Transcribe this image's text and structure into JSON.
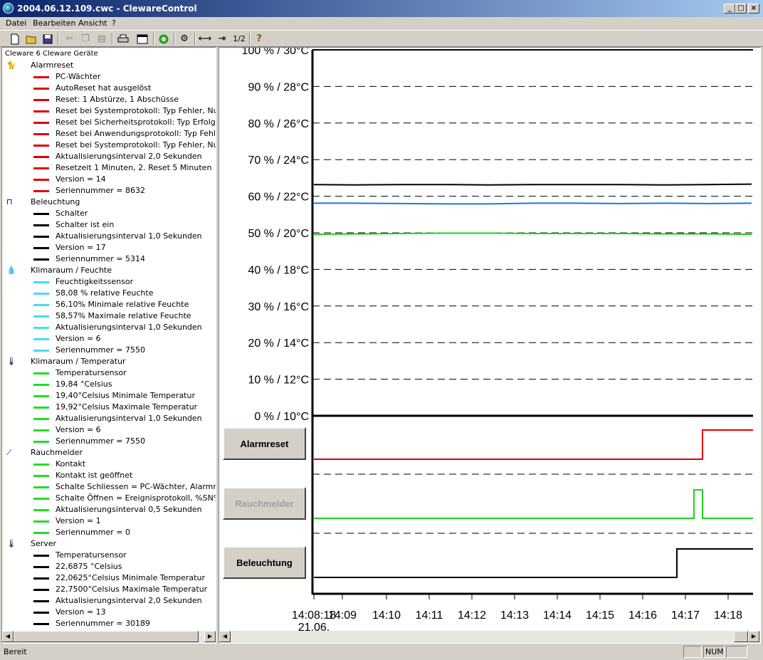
{
  "window": {
    "title": "2004.06.12.109.cwc - ClewareControl",
    "min": "_",
    "max": "□",
    "close": "×"
  },
  "menu": [
    "Datei",
    "Bearbeiten",
    "Ansicht",
    "?"
  ],
  "toolbar": {
    "zoom_label": "1/2"
  },
  "tree": {
    "root": "Cleware 6 Cleware Geräte",
    "groups": [
      {
        "label": "Alarmreset",
        "icon": "cat-alarm-icon",
        "color": "#e00000",
        "items": [
          "PC-Wächter",
          "AutoReset hat ausgelöst",
          "Reset: 1 Abstürze, 1 Abschüsse",
          "Reset bei Systemprotokoll: Typ Fehler, Nummer",
          "Reset bei Sicherheitsprotokoll: Typ Erfolgsüber",
          "Reset bei Anwendungsprotokoll: Typ Fehler, Nu",
          "Reset bei Systemprotokoll: Typ Fehler, Numme",
          "Aktualisierungsinterval 2,0 Sekunden",
          "Resetzeit 1 Minuten, 2. Reset 5 Minuten",
          "Version = 14",
          "Seriennummer = 8632"
        ]
      },
      {
        "label": "Beleuchtung",
        "icon": "switch-icon",
        "color": "#000000",
        "items": [
          "Schalter",
          "Schalter ist ein",
          "Aktualisierungsinterval 1,0 Sekunden",
          "Version = 17",
          "Seriennummer = 5314"
        ]
      },
      {
        "label": "Klimaraum / Feuchte",
        "icon": "water-drops-icon",
        "color": "#40e0f0",
        "items": [
          "Feuchtigkeitssensor",
          "58,08 % relative Feuchte",
          "56,10%  Minimale relative Feuchte",
          "58,57%  Maximale relative Feuchte",
          "Aktualisierungsinterval 1,0 Sekunden",
          "Version = 6",
          "Seriennummer = 7550"
        ]
      },
      {
        "label": "Klimaraum / Temperatur",
        "icon": "thermometer-icon",
        "color": "#20e020",
        "items": [
          "Temperatursensor",
          "19,84 °Celsius",
          "19,40°Celsius Minimale Temperatur",
          "19,92°Celsius Maximale Temperatur",
          "Aktualisierungsinterval 1,0 Sekunden",
          "Version = 6",
          "Seriennummer = 7550"
        ]
      },
      {
        "label": "Rauchmelder",
        "icon": "contact-switch-icon",
        "color": "#20e020",
        "items": [
          "Kontakt",
          "Kontakt ist geöffnet",
          "Schalte Schliessen = PC-Wächter, Alarmreset",
          "Schalte Öffnen = Ereignisprotokoll, %SN%:  ge",
          "Aktualisierungsinterval 0,5 Sekunden",
          "Version = 1",
          "Seriennummer = 0"
        ]
      },
      {
        "label": "Server",
        "icon": "remote-thermometer-icon",
        "color": "#000000",
        "items": [
          "Temperatursensor",
          "22,6875 °Celsius",
          "22,0625°Celsius Minimale Temperatur",
          "22,7500°Celsius Maximale Temperatur",
          "Aktualisierungsinterval 2,0 Sekunden",
          "Version = 13",
          "Seriennummer = 30189"
        ]
      }
    ]
  },
  "buttons": {
    "alarmreset": "Alarmreset",
    "rauchmelder": "Rauchmelder",
    "beleuchtung": "Beleuchtung"
  },
  "status": {
    "text": "Bereit",
    "num": "NUM"
  },
  "chart_data": {
    "type": "line",
    "y_tick_labels": [
      "100 % /  30°C",
      "90 % /  28°C",
      "80 % /  26°C",
      "70 % /  24°C",
      "60 % /  22°C",
      "50 % /  20°C",
      "40 % /  18°C",
      "30 % /  16°C",
      "20 % /  14°C",
      "10 % /  12°C",
      "0 % /  10°C"
    ],
    "ylim_percent": [
      0,
      100
    ],
    "x_tick_labels": [
      "14:08:18",
      "14:09",
      "14:10",
      "14:11",
      "14:12",
      "14:13",
      "14:14",
      "14:15",
      "14:16",
      "14:17",
      "14:18"
    ],
    "x_date_label": "21.06.",
    "grid": true,
    "series": [
      {
        "color": "#000000",
        "values_percent": [
          63.2,
          63.1,
          63.2,
          63.2,
          63.1,
          63.2,
          63.2,
          63.2,
          63.1,
          63.2,
          63.3
        ]
      },
      {
        "color": "#1e78dc",
        "values_percent": [
          58.1,
          58.1,
          58.0,
          57.9,
          57.9,
          58.1,
          58.1,
          58.0,
          58.1,
          58.0,
          58.1
        ]
      },
      {
        "color": "#20d020",
        "values_percent": [
          49.6,
          49.7,
          49.8,
          49.9,
          49.9,
          49.8,
          49.8,
          49.8,
          49.7,
          49.7,
          49.6
        ]
      }
    ],
    "digital": [
      {
        "name": "Alarmreset",
        "color": "#e00000",
        "transitions": [
          [
            "14:08:18",
            0
          ],
          [
            "14:17:24",
            1
          ]
        ]
      },
      {
        "name": "Rauchmelder",
        "color": "#20d020",
        "transitions": [
          [
            "14:08:18",
            0
          ],
          [
            "14:17:12",
            1
          ],
          [
            "14:17:24",
            0
          ]
        ]
      },
      {
        "name": "Beleuchtung",
        "color": "#000000",
        "transitions": [
          [
            "14:08:18",
            0
          ],
          [
            "14:16:48",
            1
          ]
        ]
      }
    ]
  }
}
